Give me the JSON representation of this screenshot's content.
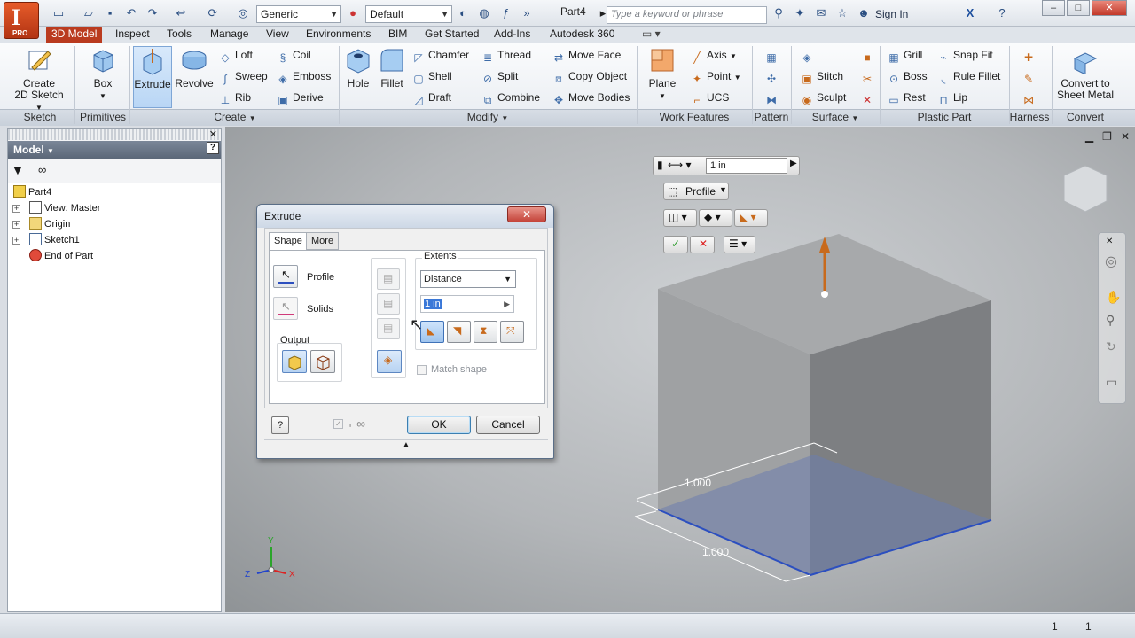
{
  "quick_access": {
    "appearance_combo": "Generic",
    "material_combo": "Default",
    "document_title": "Part4",
    "search_placeholder": "Type a keyword or phrase",
    "sign_in": "Sign In",
    "app_badge": "I",
    "app_edition": "PRO"
  },
  "tabs": [
    "3D Model",
    "Inspect",
    "Tools",
    "Manage",
    "View",
    "Environments",
    "BIM",
    "Get Started",
    "Add-Ins",
    "Autodesk 360"
  ],
  "ribbon": {
    "sketch": {
      "create_2d_sketch_line1": "Create",
      "create_2d_sketch_line2": "2D Sketch",
      "panel": "Sketch"
    },
    "primitives": {
      "box": "Box",
      "panel": "Primitives"
    },
    "create": {
      "extrude": "Extrude",
      "revolve": "Revolve",
      "loft": "Loft",
      "sweep": "Sweep",
      "rib": "Rib",
      "coil": "Coil",
      "emboss": "Emboss",
      "derive": "Derive",
      "panel": "Create"
    },
    "modify": {
      "hole": "Hole",
      "fillet": "Fillet",
      "chamfer": "Chamfer",
      "shell": "Shell",
      "draft": "Draft",
      "thread": "Thread",
      "split": "Split",
      "combine": "Combine",
      "move_face": "Move Face",
      "copy_object": "Copy Object",
      "move_bodies": "Move Bodies",
      "panel": "Modify"
    },
    "work_features": {
      "plane": "Plane",
      "axis": "Axis",
      "point": "Point",
      "ucs": "UCS",
      "panel": "Work Features"
    },
    "pattern": {
      "panel": "Pattern"
    },
    "surface": {
      "stitch": "Stitch",
      "sculpt": "Sculpt",
      "panel": "Surface"
    },
    "plastic_part": {
      "grill": "Grill",
      "boss": "Boss",
      "rest": "Rest",
      "snap_fit": "Snap Fit",
      "rule_fillet": "Rule Fillet",
      "lip": "Lip",
      "panel": "Plastic Part"
    },
    "harness": {
      "panel": "Harness"
    },
    "convert": {
      "line1": "Convert to",
      "line2": "Sheet Metal",
      "panel": "Convert"
    }
  },
  "browser": {
    "title": "Model",
    "tree": [
      "Part4",
      "View: Master",
      "Origin",
      "Sketch1",
      "End of Part"
    ]
  },
  "viewport": {
    "mini_toolbar": {
      "distance": "1 in",
      "profile": "Profile"
    },
    "dimension_top": "1.000",
    "dimension_bottom": "1.000"
  },
  "dialog": {
    "title": "Extrude",
    "tabs": [
      "Shape",
      "More"
    ],
    "profile_label": "Profile",
    "solids_label": "Solids",
    "output_label": "Output",
    "extents_label": "Extents",
    "extents_value": "Distance",
    "distance_value": "1 in",
    "match_shape_label": "Match shape",
    "ok": "OK",
    "cancel": "Cancel"
  },
  "status": {
    "value1": "1",
    "value2": "1"
  },
  "colors": {
    "accent": "#ba3b1f",
    "selection": "#3a78d8",
    "profile_blue": "#2c4fbf",
    "arrow": "#c86a1c"
  }
}
